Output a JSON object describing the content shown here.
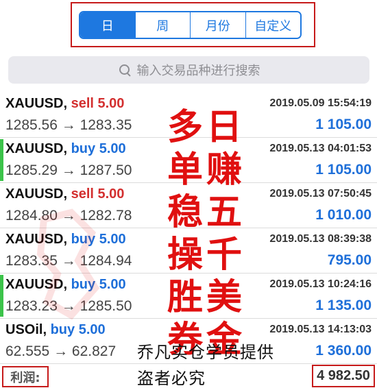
{
  "period_tabs": [
    "日",
    "周",
    "月份",
    "自定义"
  ],
  "active_tab_index": 0,
  "search": {
    "placeholder": "输入交易品种进行搜索",
    "icon": "search-icon"
  },
  "trades": [
    {
      "symbol": "XAUUSD,",
      "side": "sell",
      "side_label": "sell 5.00",
      "prices": "1285.56 → 1283.35",
      "time": "2019.05.09 15:54:19",
      "profit": "1 105.00",
      "marked": false
    },
    {
      "symbol": "XAUUSD,",
      "side": "buy",
      "side_label": "buy 5.00",
      "prices": "1285.29 → 1287.50",
      "time": "2019.05.13 04:01:53",
      "profit": "1 105.00",
      "marked": true
    },
    {
      "symbol": "XAUUSD,",
      "side": "sell",
      "side_label": "sell 5.00",
      "prices": "1284.80 → 1282.78",
      "time": "2019.05.13 07:50:45",
      "profit": "1 010.00",
      "marked": false
    },
    {
      "symbol": "XAUUSD,",
      "side": "buy",
      "side_label": "buy 5.00",
      "prices": "1283.35 → 1284.94",
      "time": "2019.05.13 08:39:38",
      "profit": "795.00",
      "marked": false
    },
    {
      "symbol": "XAUUSD,",
      "side": "buy",
      "side_label": "buy 5.00",
      "prices": "1283.23 → 1285.50",
      "time": "2019.05.13 10:24:16",
      "profit": "1 135.00",
      "marked": true
    },
    {
      "symbol": "USOil,",
      "side": "buy",
      "side_label": "buy 5.00",
      "prices": "62.555 → 62.827",
      "time": "2019.05.13 14:13:03",
      "profit": "1 360.00",
      "marked": false
    }
  ],
  "footer": {
    "label": "利润:",
    "total": "4 982.50"
  },
  "overlay": {
    "col_a": [
      "多",
      "单",
      "稳",
      "操",
      "胜",
      "券"
    ],
    "col_b": [
      "日",
      "赚",
      "五",
      "千",
      "美",
      "金"
    ],
    "credit_line1": "乔凡实仓学员提供",
    "credit_line2": "盗者必究"
  },
  "colors": {
    "accent": "#1e78e0",
    "sell": "#d32f2f",
    "buy": "#1e6fd9",
    "highlight_box": "#c61a1a",
    "overlay_text": "#e01010",
    "row_marker": "#3cc34a"
  }
}
